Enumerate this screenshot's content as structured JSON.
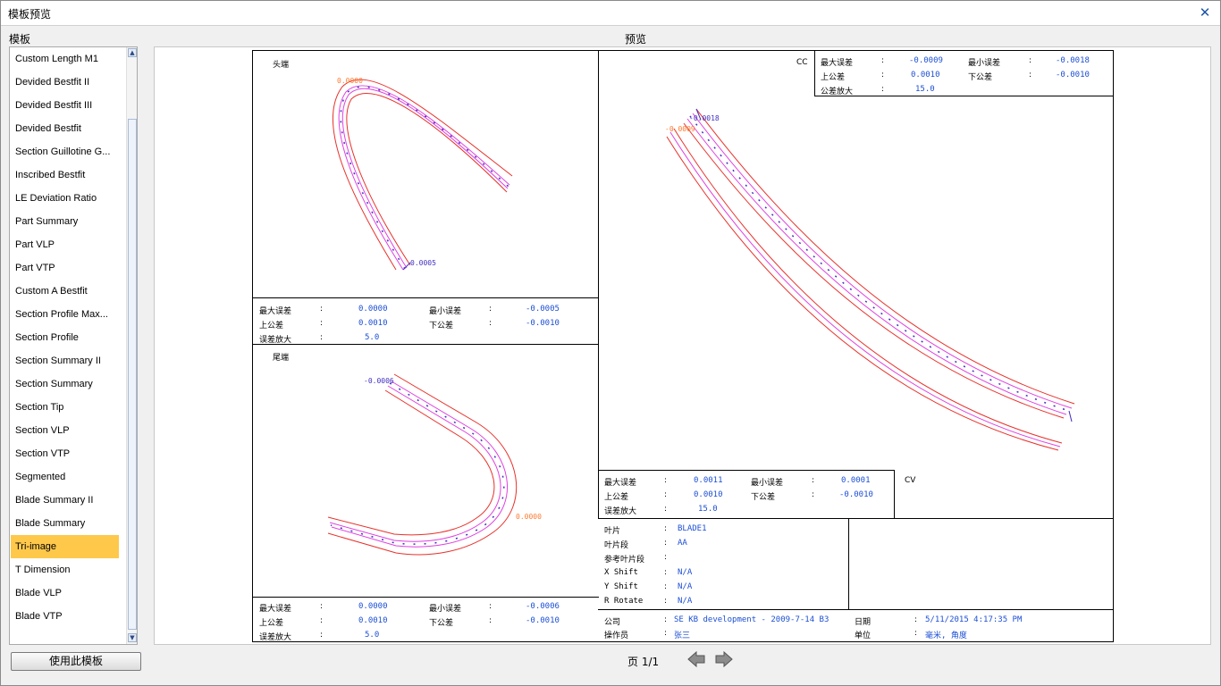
{
  "window": {
    "title": "模板预览",
    "close_symbol": "✕"
  },
  "left_panel": {
    "label": "模板",
    "items": [
      "Custom Length M1",
      "Devided Bestfit II",
      "Devided Bestfit III",
      "Devided Bestfit",
      "Section Guillotine G...",
      "Inscribed Bestfit",
      "LE Deviation Ratio",
      "Part Summary",
      "Part VLP",
      "Part VTP",
      "Custom A Bestfit",
      "Section Profile Max...",
      "Section Profile",
      "Section Summary II",
      "Section Summary",
      "Section Tip",
      "Section VLP",
      "Section VTP",
      "Segmented",
      "Blade Summary II",
      "Blade Summary",
      "Tri-image",
      "T Dimension",
      "Blade VLP",
      "Blade VTP"
    ],
    "selected": "Tri-image",
    "use_button": "使用此模板"
  },
  "preview": {
    "label": "预览",
    "page_text": "页 1/1",
    "head": {
      "title": "头端",
      "tag_top": "0.0000",
      "tag_bottom": "0.0005",
      "max_err_label": "最大误差",
      "max_err": "0.0000",
      "min_err_label": "最小误差",
      "min_err": "-0.0005",
      "upper_label": "上公差",
      "upper": "0.0010",
      "lower_label": "下公差",
      "lower": "-0.0010",
      "mag_label": "误差放大",
      "mag": "5.0"
    },
    "tail": {
      "title": "尾端",
      "tag_top": "-0.0006",
      "tag_right": "0.0000",
      "max_err_label": "最大误差",
      "max_err": "0.0000",
      "min_err_label": "最小误差",
      "min_err": "-0.0006",
      "upper_label": "上公差",
      "upper": "0.0010",
      "lower_label": "下公差",
      "lower": "-0.0010",
      "mag_label": "误差放大",
      "mag": "5.0"
    },
    "cc": {
      "title": "CC",
      "tag_top": "-0.0018",
      "tag_left": "-0.0009",
      "max_err_label": "最大误差",
      "max_err": "-0.0009",
      "min_err_label": "最小误差",
      "min_err": "-0.0018",
      "upper_label": "上公差",
      "upper": "0.0010",
      "lower_label": "下公差",
      "lower": "-0.0010",
      "mag_label": "公差放大",
      "mag": "15.0"
    },
    "cv": {
      "title": "CV",
      "max_err_label": "最大误差",
      "max_err": "0.0011",
      "min_err_label": "最小误差",
      "min_err": "0.0001",
      "upper_label": "上公差",
      "upper": "0.0010",
      "lower_label": "下公差",
      "lower": "-0.0010",
      "mag_label": "误差放大",
      "mag": "15.0"
    },
    "info": {
      "blade_label": "叶片",
      "blade": "BLADE1",
      "section_label": "叶片段",
      "section": "AA",
      "ref_label": "参考叶片段",
      "ref": "",
      "xshift_label": "X Shift",
      "xshift": "N/A",
      "yshift_label": "Y Shift",
      "yshift": "N/A",
      "rrot_label": "R Rotate",
      "rrot": "N/A",
      "company_label": "公司",
      "company": "SE KB development - 2009-7-14 B3",
      "operator_label": "操作员",
      "operator": "张三",
      "date_label": "日期",
      "date": "5/11/2015 4:17:35 PM",
      "unit_label": "单位",
      "unit": "毫米, 角度"
    }
  },
  "colors": {
    "selection": "#fec84b",
    "value_blue": "#1c4fd6",
    "tol_red": "#e8302a",
    "nominal_magenta": "#e040e0",
    "measured_blue": "#4030c0",
    "tag_orange": "#ff7a30"
  }
}
